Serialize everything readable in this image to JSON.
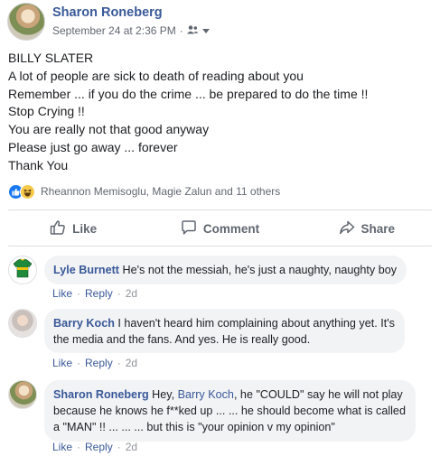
{
  "post": {
    "author": "Sharon Roneberg",
    "timestamp": "September 24 at 2:36 PM",
    "separator": "·",
    "audience_icon": "friends-icon",
    "lines": [
      "BILLY SLATER",
      "A lot of people are sick to death of reading about you",
      "Remember ... if you do the crime ... be prepared to do the time !!",
      "Stop Crying !!",
      "You are really not that good anyway",
      "Please just go away ... forever",
      "Thank You"
    ],
    "reactions": {
      "icons": [
        "like-icon",
        "haha-icon"
      ],
      "summary": "Rheannon Memisoglu, Magie Zalun and 11 others"
    }
  },
  "actions": {
    "like": "Like",
    "comment": "Comment",
    "share": "Share"
  },
  "comments": [
    {
      "author": "Lyle Burnett",
      "text": "He's not the messiah, he's just a naughty, naughty boy",
      "like": "Like",
      "reply": "Reply",
      "time": "2d",
      "avatar_icon": "jersey-icon"
    },
    {
      "author": "Barry Koch",
      "text_line1": "I haven't heard him complaining about anything yet. It's",
      "text_line2": "the media and the fans. And yes. He is really good.",
      "like": "Like",
      "reply": "Reply",
      "time": "2d"
    },
    {
      "author": "Sharon Roneberg",
      "text_a": "Hey,",
      "mention": "Barry Koch",
      "text_b": ", he \"COULD\" say he will not play",
      "text_line2": "because he knows he f**ked up ... ... he should become what is called",
      "text_line3": "a \"MAN\" !! ... ... ... but this is \"your opinion v my opinion\"",
      "like": "Like",
      "reply": "Reply",
      "time": "2d"
    }
  ],
  "colors": {
    "link": "#385898",
    "muted": "#616770",
    "bubble": "#f2f3f5",
    "like_blue": "#1877f2"
  }
}
